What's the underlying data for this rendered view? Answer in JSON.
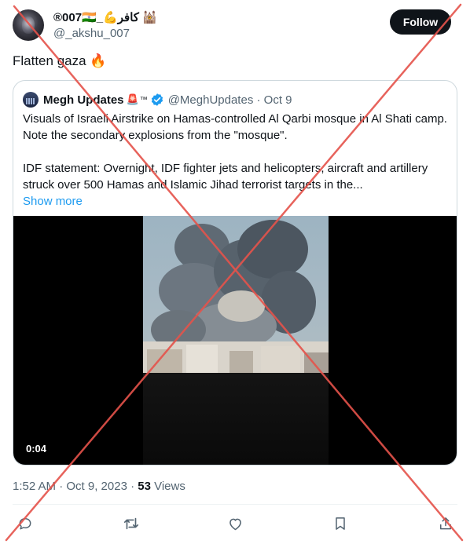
{
  "author": {
    "display_name": "®007🇮🇳_💪كافر 🕍",
    "handle": "@_akshu_007"
  },
  "follow_label": "Follow",
  "tweet_text": "Flatten gaza 🔥",
  "quoted": {
    "name": "Megh Updates",
    "name_emoji": "🚨",
    "tm": "™",
    "handle_date": "@MeghUpdates · Oct 9",
    "body_line1": "Visuals of Israeli Airstrike on Hamas-controlled Al Qarbi mosque in Al Shati camp.",
    "body_line2": "Note the secondary explosions from the \"mosque\".",
    "body_line3": "IDF statement: Overnight, IDF fighter jets and helicopters, aircraft and artillery",
    "body_line4": "struck over 500 Hamas and Islamic Jihad terrorist targets in the...",
    "show_more": "Show more",
    "video_time": "0:04"
  },
  "meta": {
    "time_date": "1:52 AM · Oct 9, 2023 · ",
    "views_count": "53",
    "views_label": " Views"
  },
  "colors": {
    "accent": "#1d9bf0",
    "cross": "#e5534b"
  },
  "icons": [
    "reply-icon",
    "retweet-icon",
    "like-icon",
    "bookmark-icon",
    "share-icon",
    "verified-icon"
  ]
}
